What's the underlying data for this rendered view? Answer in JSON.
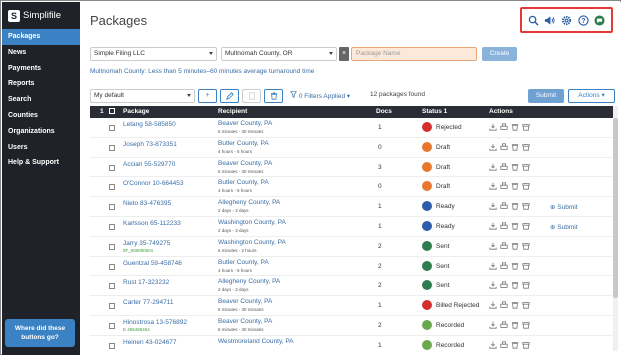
{
  "app": {
    "name": "Simplifile"
  },
  "sidebar": {
    "items": [
      {
        "label": "Packages"
      },
      {
        "label": "News"
      },
      {
        "label": "Payments"
      },
      {
        "label": "Reports"
      },
      {
        "label": "Search"
      },
      {
        "label": "Counties"
      },
      {
        "label": "Organizations"
      },
      {
        "label": "Users"
      },
      {
        "label": "Help & Support"
      }
    ],
    "help_button": {
      "line1": "Where did these",
      "line2": "buttons go?"
    }
  },
  "header": {
    "title": "Packages",
    "icons": [
      "search-icon",
      "megaphone-icon",
      "gear-icon",
      "help-icon",
      "chat-icon"
    ]
  },
  "filters": {
    "organization": "Simple Filing LLC",
    "county": "Multnomah County, OR",
    "clear_label": "×",
    "package_name_placeholder": "Package Name",
    "create_label": "Create",
    "turnaround_text": "Multnomah County: Less than 5 minutes–60 minutes average turnaround time"
  },
  "toolbar": {
    "view": "My default",
    "add_label": "+",
    "filters_label": "0 Filters Applied",
    "found_text": "12 packages found",
    "submit_label": "Submit",
    "actions_label": "Actions"
  },
  "table": {
    "headers": {
      "count": "1",
      "package": "Package",
      "recipient": "Recipient",
      "docs": "Docs",
      "status": "Status 1",
      "actions": "Actions"
    },
    "rows": [
      {
        "package": "Letang 58-585850",
        "pkg_sub": "",
        "recipient": "Beaver County, PA",
        "rec_sub": "5 minutes - 30 minutes",
        "docs": "1",
        "status": "Rejected",
        "status_color": "#d32f2f",
        "status_icon": "rejected-icon",
        "submit": ""
      },
      {
        "package": "Joseph 73-873351",
        "pkg_sub": "",
        "recipient": "Butler County, PA",
        "rec_sub": "4 hours - 5 hours",
        "docs": "0",
        "status": "Draft",
        "status_color": "#e8772e",
        "status_icon": "draft-icon",
        "submit": ""
      },
      {
        "package": "Acciari 55-529770",
        "pkg_sub": "",
        "recipient": "Beaver County, PA",
        "rec_sub": "5 minutes - 30 minutes",
        "docs": "3",
        "status": "Draft",
        "status_color": "#e8772e",
        "status_icon": "draft-icon",
        "submit": ""
      },
      {
        "package": "O'Connor 10-664453",
        "pkg_sub": "",
        "recipient": "Butler County, PA",
        "rec_sub": "4 hours - 5 hours",
        "docs": "0",
        "status": "Draft",
        "status_color": "#e8772e",
        "status_icon": "draft-icon",
        "submit": ""
      },
      {
        "package": "Nieto 83-476395",
        "pkg_sub": "",
        "recipient": "Allegheny County, PA",
        "rec_sub": "2 days - 3 days",
        "docs": "1",
        "status": "Ready",
        "status_color": "#2b5da8",
        "status_icon": "ready-icon",
        "submit": "Submit"
      },
      {
        "package": "Karlsson 65-112233",
        "pkg_sub": "",
        "recipient": "Washington County, PA",
        "rec_sub": "2 days - 3 days",
        "docs": "1",
        "status": "Ready",
        "status_color": "#2b5da8",
        "status_icon": "ready-icon",
        "submit": "Submit"
      },
      {
        "package": "Jarry 35-749275",
        "pkg_sub": "5F_000000001",
        "recipient": "Washington County, PA",
        "rec_sub": "5 minutes - 2 hours",
        "docs": "2",
        "status": "Sent",
        "status_color": "#2e7d4f",
        "status_icon": "sent-icon",
        "submit": ""
      },
      {
        "package": "Guentzal 59-458746",
        "pkg_sub": "",
        "recipient": "Butler County, PA",
        "rec_sub": "4 hours - 5 hours",
        "docs": "2",
        "status": "Sent",
        "status_color": "#2e7d4f",
        "status_icon": "sent-icon",
        "submit": ""
      },
      {
        "package": "Rust 17-323232",
        "pkg_sub": "",
        "recipient": "Allegheny County, PA",
        "rec_sub": "2 days - 3 days",
        "docs": "2",
        "status": "Sent",
        "status_color": "#2e7d4f",
        "status_icon": "sent-icon",
        "submit": ""
      },
      {
        "package": "Carter 77-294711",
        "pkg_sub": "",
        "recipient": "Beaver County, PA",
        "rec_sub": "5 minutes - 30 minutes",
        "docs": "1",
        "status": "Billed Rejected",
        "status_color": "#d32f2f",
        "status_icon": "billed-rejected-icon",
        "submit": ""
      },
      {
        "package": "Hinostrosa 13-576892",
        "pkg_sub": "E 465465464",
        "recipient": "Beaver County, PA",
        "rec_sub": "5 minutes - 30 minutes",
        "docs": "2",
        "status": "Recorded",
        "status_color": "#6aa84f",
        "status_icon": "recorded-icon",
        "submit": ""
      },
      {
        "package": "Heinen 43-024677",
        "pkg_sub": "",
        "recipient": "Westmoreland County, PA",
        "rec_sub": "",
        "docs": "1",
        "status": "Recorded",
        "status_color": "#6aa84f",
        "status_icon": "recorded-icon",
        "submit": ""
      }
    ]
  }
}
